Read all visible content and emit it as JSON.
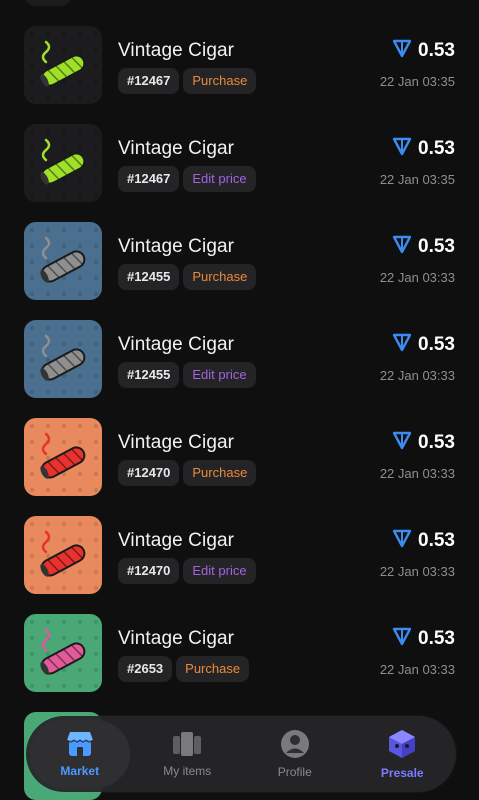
{
  "currency_icon": "ton-diamond-icon",
  "colors": {
    "purchase": "#e98a3a",
    "edit_price": "#a463e0",
    "ton": "#3b8cf0",
    "tab_active": "#4a9bff",
    "presale": "#7d7bff"
  },
  "items": [
    {
      "title": "Vintage Cigar",
      "number": "#12467",
      "action": "Purchase",
      "action_type": "purchase",
      "price": "0.53",
      "date": "22 Jan 03:35",
      "bg": "#1c1c1e",
      "cigar": "#9ee02a"
    },
    {
      "title": "Vintage Cigar",
      "number": "#12467",
      "action": "Edit price",
      "action_type": "edit",
      "price": "0.53",
      "date": "22 Jan 03:35",
      "bg": "#1c1c1e",
      "cigar": "#9ee02a"
    },
    {
      "title": "Vintage Cigar",
      "number": "#12455",
      "action": "Purchase",
      "action_type": "purchase",
      "price": "0.53",
      "date": "22 Jan 03:33",
      "bg": "#4a6f8f",
      "cigar": "#8f8f8f"
    },
    {
      "title": "Vintage Cigar",
      "number": "#12455",
      "action": "Edit price",
      "action_type": "edit",
      "price": "0.53",
      "date": "22 Jan 03:33",
      "bg": "#4a6f8f",
      "cigar": "#8f8f8f"
    },
    {
      "title": "Vintage Cigar",
      "number": "#12470",
      "action": "Purchase",
      "action_type": "purchase",
      "price": "0.53",
      "date": "22 Jan 03:33",
      "bg": "#e98a5e",
      "cigar": "#e8322e"
    },
    {
      "title": "Vintage Cigar",
      "number": "#12470",
      "action": "Edit price",
      "action_type": "edit",
      "price": "0.53",
      "date": "22 Jan 03:33",
      "bg": "#e98a5e",
      "cigar": "#e8322e"
    },
    {
      "title": "Vintage Cigar",
      "number": "#2653",
      "action": "Purchase",
      "action_type": "purchase",
      "price": "0.53",
      "date": "22 Jan 03:33",
      "bg": "#4aa877",
      "cigar": "#e35a9a"
    }
  ],
  "tabs": [
    {
      "label": "Market",
      "icon": "store-icon",
      "active": true
    },
    {
      "label": "My items",
      "icon": "cards-icon",
      "active": false
    },
    {
      "label": "Profile",
      "icon": "profile-icon",
      "active": false
    },
    {
      "label": "Presale",
      "icon": "presale-cube-icon",
      "active": false
    }
  ]
}
